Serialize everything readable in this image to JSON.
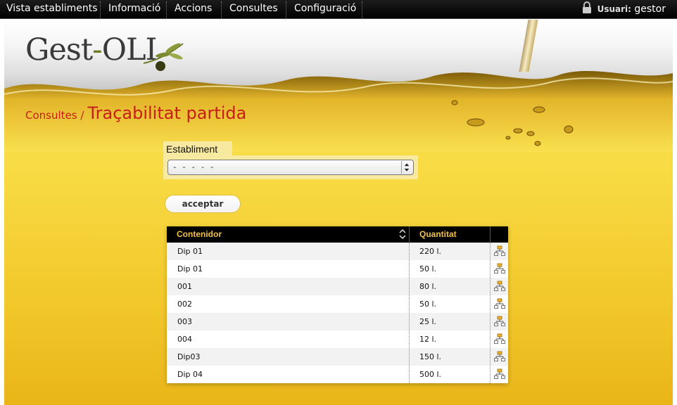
{
  "nav": {
    "items": [
      {
        "label": "Vista establiments"
      },
      {
        "label": "Informació"
      },
      {
        "label": "Accions"
      },
      {
        "label": "Consultes"
      },
      {
        "label": "Configuració"
      }
    ],
    "user_label": "Usuari:",
    "user_name": "gestor",
    "icon": "lock-icon"
  },
  "logo": {
    "part1": "Gest",
    "dash": "-",
    "part2": "OLI"
  },
  "breadcrumb": {
    "parent": "Consultes /",
    "current": "Traçabilitat partida"
  },
  "form": {
    "establiment_label": "Establiment",
    "establiment_value": "- - - - -",
    "submit_label": "acceptar"
  },
  "table": {
    "headers": {
      "container": "Contenidor",
      "quantity": "Quantitat"
    },
    "rows": [
      {
        "container": "Dip 01",
        "quantity": "220 l."
      },
      {
        "container": "Dip 01",
        "quantity": "50 l."
      },
      {
        "container": "001",
        "quantity": "80 l."
      },
      {
        "container": "002",
        "quantity": "50 l."
      },
      {
        "container": "003",
        "quantity": "25 l."
      },
      {
        "container": "004",
        "quantity": "12 l."
      },
      {
        "container": "Dip03",
        "quantity": "150 l."
      },
      {
        "container": "Dip 04",
        "quantity": "500 l."
      }
    ],
    "row_icon": "tree-icon"
  },
  "colors": {
    "accent": "#c71e18",
    "header_text": "#f3c24a",
    "oil": "#f8dc45"
  }
}
